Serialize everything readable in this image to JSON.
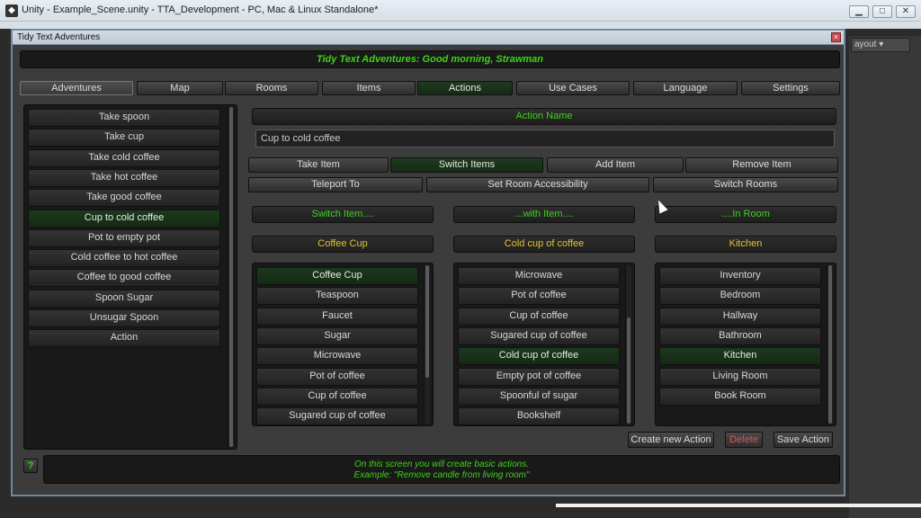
{
  "os": {
    "title": "Unity - Example_Scene.unity - TTA_Development - PC, Mac & Linux Standalone*",
    "app_icon": "unity-icon",
    "minimize": "▁",
    "maximize": "□",
    "close": "✕",
    "layout_dropdown": "ayout ▾"
  },
  "dialog": {
    "title": "Tidy Text Adventures",
    "close": "×",
    "banner": "Tidy Text Adventures: Good morning, Strawman"
  },
  "tabs": [
    "Adventures",
    "Map",
    "Rooms",
    "Items",
    "Actions",
    "Use Cases",
    "Language",
    "Settings"
  ],
  "actions_list": {
    "items": [
      "Take spoon",
      "Take cup",
      "Take cold coffee",
      "Take hot coffee",
      "Take good coffee",
      "Cup to cold coffee",
      "Pot to empty pot",
      "Cold coffee to hot coffee",
      "Coffee to good coffee",
      "Spoon Sugar",
      "Unsugar Spoon",
      "Action"
    ],
    "selected": "Cup to cold coffee"
  },
  "action_name": {
    "label": "Action Name",
    "value": "Cup to cold coffee"
  },
  "action_types_row1": [
    "Take Item",
    "Switch Items",
    "Add Item",
    "Remove Item"
  ],
  "action_types_row2": [
    "Teleport To",
    "Set Room Accessibility",
    "Switch Rooms"
  ],
  "selected_action_type": "Switch Items",
  "columns": {
    "switch_item": {
      "header": "Switch Item....",
      "value": "Coffee Cup",
      "items": [
        "Coffee Cup",
        "Teaspoon",
        "Faucet",
        "Sugar",
        "Microwave",
        "Pot of coffee",
        "Cup of coffee",
        "Sugared cup of coffee"
      ],
      "selected": "Coffee Cup"
    },
    "with_item": {
      "header": "...with Item....",
      "value": "Cold cup of coffee",
      "items": [
        "Microwave",
        "Pot of coffee",
        "Cup of coffee",
        "Sugared cup of coffee",
        "Cold cup of coffee",
        "Empty pot of coffee",
        "Spoonful of sugar",
        "Bookshelf"
      ],
      "selected": "Cold cup of coffee"
    },
    "in_room": {
      "header": "....In Room",
      "value": "Kitchen",
      "items": [
        "Inventory",
        "Bedroom",
        "Hallway",
        "Bathroom",
        "Kitchen",
        "Living Room",
        "Book Room"
      ],
      "selected": "Kitchen"
    }
  },
  "footer_buttons": {
    "create": "Create new Action",
    "delete": "Delete",
    "save": "Save Action"
  },
  "help": {
    "button": "?",
    "line1": "On this screen you will create basic actions.",
    "line2": "Example: \"Remove candle from living room\""
  },
  "colors": {
    "green_text": "#3cd417",
    "yellow_text": "#e3c427",
    "delete_red": "#e05050"
  }
}
